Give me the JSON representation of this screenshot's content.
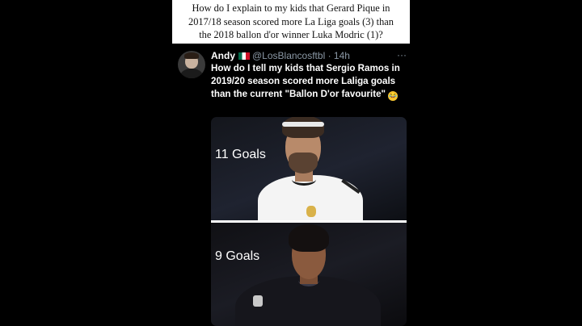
{
  "caption": {
    "line1": "How do I explain to my kids that Gerard Pique in",
    "line2": "2017/18 season scored more La Liga goals (3) than",
    "line3": "the 2018 ballon d'or winner Luka Modric (1)?"
  },
  "tweet": {
    "author_name": "Andy",
    "flag": "mexico-flag",
    "handle": "@LosBlancosftbl",
    "separator": "·",
    "time": "14h",
    "more": "···",
    "text": "How do I tell my kids that Sergio Ramos in 2019/20 season scored more Laliga goals than the current \"Ballon D'or favourite\"",
    "emoji": "laughing-crying-emoji",
    "media": [
      {
        "label": "11 Goals"
      },
      {
        "label": "9 Goals"
      }
    ]
  }
}
